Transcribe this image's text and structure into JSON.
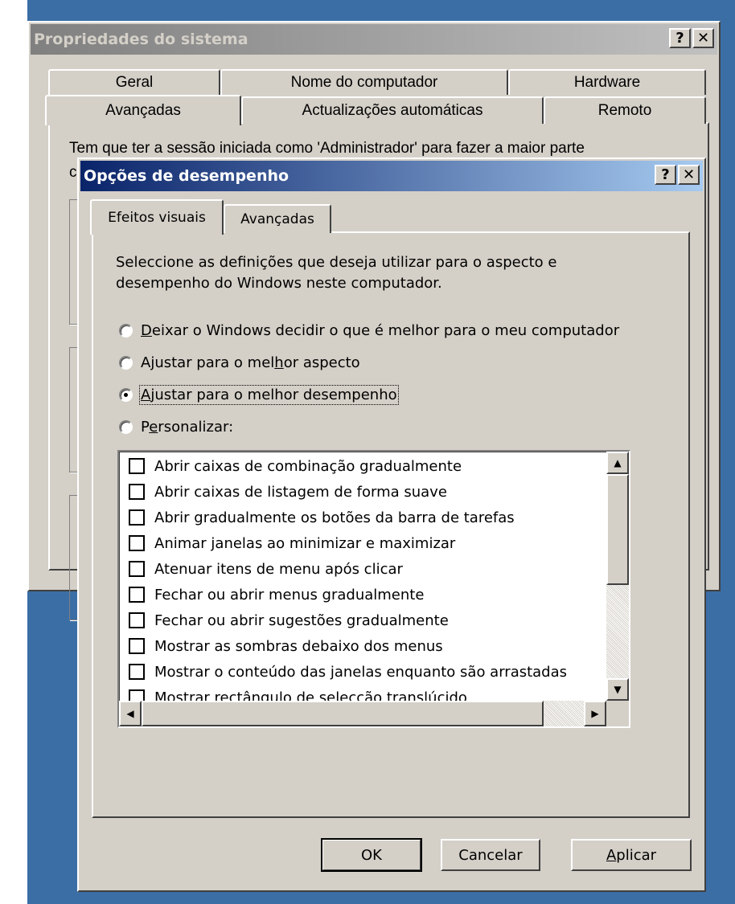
{
  "back_window": {
    "title": "Propriedades do sistema",
    "help_label": "?",
    "close_label": "✕",
    "tabs_row1": [
      "Geral",
      "Nome do computador",
      "Hardware"
    ],
    "tabs_row2": [
      "Avançadas",
      "Actualizações automáticas",
      "Remoto"
    ],
    "intro_text": "Tem que ter a sessão iniciada como 'Administrador' para fazer a maior parte",
    "intro_text_2_partial": "c"
  },
  "dialog": {
    "title": "Opções de desempenho",
    "help_label": "?",
    "close_label": "✕",
    "tabs": [
      "Efeitos visuais",
      "Avançadas"
    ],
    "active_tab": "Efeitos visuais",
    "description_line1": "Seleccione as definições que deseja utilizar para o aspecto e",
    "description_line2": "desempenho do Windows neste computador.",
    "options": [
      {
        "pre": "",
        "key": "D",
        "post": "eixar o Windows decidir o que é melhor para o meu computador",
        "checked": false
      },
      {
        "pre": "Ajustar para o mel",
        "key": "h",
        "post": "or aspecto",
        "checked": false
      },
      {
        "pre": "",
        "key": "A",
        "post": "justar para o melhor desempenho",
        "checked": true
      },
      {
        "pre": "P",
        "key": "e",
        "post": "rsonalizar:",
        "checked": false
      }
    ],
    "effects": [
      {
        "label": "Abrir caixas de combinação gradualmente",
        "checked": false
      },
      {
        "label": "Abrir caixas de listagem de forma suave",
        "checked": false
      },
      {
        "label": "Abrir gradualmente os botões da barra de tarefas",
        "checked": false
      },
      {
        "label": "Animar janelas ao minimizar e maximizar",
        "checked": false
      },
      {
        "label": "Atenuar itens de menu após clicar",
        "checked": false
      },
      {
        "label": "Fechar ou abrir menus gradualmente",
        "checked": false
      },
      {
        "label": "Fechar ou abrir sugestões gradualmente",
        "checked": false
      },
      {
        "label": "Mostrar as sombras debaixo dos menus",
        "checked": false
      },
      {
        "label": "Mostrar o conteúdo das janelas enquanto são arrastadas",
        "checked": false
      },
      {
        "label": "Mostrar rectângulo de selecção translúcido",
        "checked": false
      }
    ],
    "buttons": {
      "ok": "OK",
      "cancel": "Cancelar",
      "apply_key": "A",
      "apply_rest": "plicar"
    }
  },
  "icons": {
    "scroll_up": "▲",
    "scroll_down": "▼",
    "scroll_left": "◀",
    "scroll_right": "▶"
  },
  "colors": {
    "desktop": "#3b6ea5",
    "face": "#d4d0c8",
    "active_title": "#0a246a",
    "inactive_title": "#808080"
  }
}
